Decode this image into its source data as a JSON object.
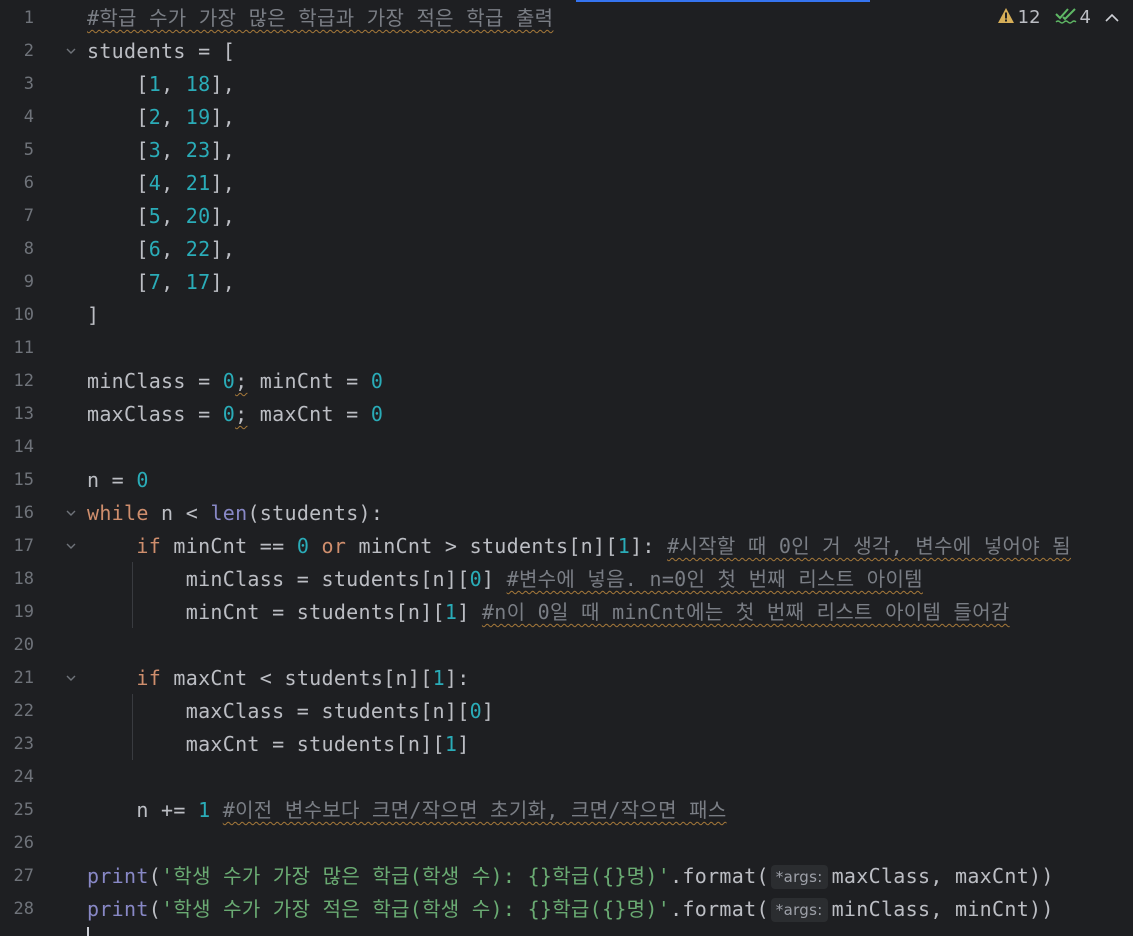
{
  "inspections": {
    "warnings_count": "12",
    "typos_count": "4",
    "warning_icon": "warning-triangle-icon",
    "typo_icon": "double-check-icon",
    "collapse_icon": "chevron-up-icon"
  },
  "colors": {
    "background": "#1e1f22",
    "keyword": "#cf8e6d",
    "number": "#2aacb8",
    "function": "#56a8f5",
    "string": "#6aab73",
    "comment": "#7a7e85"
  },
  "lines": [
    {
      "n": "1",
      "tokens": [
        {
          "t": "#학급 수가 가장 많은 학급과 가장 적은 학급 출력",
          "c": "cm"
        }
      ]
    },
    {
      "n": "2",
      "fold": true,
      "tokens": [
        {
          "t": "students = ["
        }
      ]
    },
    {
      "n": "3",
      "tokens": [
        {
          "t": "    ["
        },
        {
          "t": "1",
          "c": "num"
        },
        {
          "t": ", "
        },
        {
          "t": "18",
          "c": "num"
        },
        {
          "t": "],"
        }
      ]
    },
    {
      "n": "4",
      "tokens": [
        {
          "t": "    ["
        },
        {
          "t": "2",
          "c": "num"
        },
        {
          "t": ", "
        },
        {
          "t": "19",
          "c": "num"
        },
        {
          "t": "],"
        }
      ]
    },
    {
      "n": "5",
      "tokens": [
        {
          "t": "    ["
        },
        {
          "t": "3",
          "c": "num"
        },
        {
          "t": ", "
        },
        {
          "t": "23",
          "c": "num"
        },
        {
          "t": "],"
        }
      ]
    },
    {
      "n": "6",
      "tokens": [
        {
          "t": "    ["
        },
        {
          "t": "4",
          "c": "num"
        },
        {
          "t": ", "
        },
        {
          "t": "21",
          "c": "num"
        },
        {
          "t": "],"
        }
      ]
    },
    {
      "n": "7",
      "tokens": [
        {
          "t": "    ["
        },
        {
          "t": "5",
          "c": "num"
        },
        {
          "t": ", "
        },
        {
          "t": "20",
          "c": "num"
        },
        {
          "t": "],"
        }
      ]
    },
    {
      "n": "8",
      "tokens": [
        {
          "t": "    ["
        },
        {
          "t": "6",
          "c": "num"
        },
        {
          "t": ", "
        },
        {
          "t": "22",
          "c": "num"
        },
        {
          "t": "],"
        }
      ]
    },
    {
      "n": "9",
      "tokens": [
        {
          "t": "    ["
        },
        {
          "t": "7",
          "c": "num"
        },
        {
          "t": ", "
        },
        {
          "t": "17",
          "c": "num"
        },
        {
          "t": "],"
        }
      ]
    },
    {
      "n": "10",
      "tokens": [
        {
          "t": "]"
        }
      ]
    },
    {
      "n": "11",
      "tokens": []
    },
    {
      "n": "12",
      "tokens": [
        {
          "t": "minClass = "
        },
        {
          "t": "0",
          "c": "num"
        },
        {
          "t": ";",
          "c": "wv"
        },
        {
          "t": " minCnt = "
        },
        {
          "t": "0",
          "c": "num"
        }
      ]
    },
    {
      "n": "13",
      "tokens": [
        {
          "t": "maxClass = "
        },
        {
          "t": "0",
          "c": "num"
        },
        {
          "t": ";",
          "c": "wv"
        },
        {
          "t": " maxCnt = "
        },
        {
          "t": "0",
          "c": "num"
        }
      ]
    },
    {
      "n": "14",
      "tokens": []
    },
    {
      "n": "15",
      "tokens": [
        {
          "t": "n = "
        },
        {
          "t": "0",
          "c": "num"
        }
      ]
    },
    {
      "n": "16",
      "fold": true,
      "tokens": [
        {
          "t": "while",
          "c": "kw"
        },
        {
          "t": " n < "
        },
        {
          "t": "len",
          "c": "bi"
        },
        {
          "t": "(students):"
        }
      ]
    },
    {
      "n": "17",
      "fold": true,
      "tokens": [
        {
          "t": "    "
        },
        {
          "t": "if",
          "c": "kw"
        },
        {
          "t": " minCnt == "
        },
        {
          "t": "0",
          "c": "num"
        },
        {
          "t": " "
        },
        {
          "t": "or",
          "c": "kw"
        },
        {
          "t": " minCnt > students[n]["
        },
        {
          "t": "1",
          "c": "num"
        },
        {
          "t": "]: "
        },
        {
          "t": "#시작할 때 0인 거 생각, 변수에 넣어야 됨",
          "c": "cm"
        }
      ]
    },
    {
      "n": "18",
      "tokens": [
        {
          "t": "        minClass = students[n]["
        },
        {
          "t": "0",
          "c": "num"
        },
        {
          "t": "] "
        },
        {
          "t": "#변수에 넣음. n=0인 첫 번째 리스트 아이템",
          "c": "cm"
        }
      ]
    },
    {
      "n": "19",
      "tokens": [
        {
          "t": "        minCnt = students[n]["
        },
        {
          "t": "1",
          "c": "num"
        },
        {
          "t": "] "
        },
        {
          "t": "#n이 0일 때 minCnt에는 첫 번째 리스트 아이템 들어감",
          "c": "cm"
        }
      ]
    },
    {
      "n": "20",
      "tokens": []
    },
    {
      "n": "21",
      "fold": true,
      "tokens": [
        {
          "t": "    "
        },
        {
          "t": "if",
          "c": "kw"
        },
        {
          "t": " maxCnt < students[n]["
        },
        {
          "t": "1",
          "c": "num"
        },
        {
          "t": "]:"
        }
      ]
    },
    {
      "n": "22",
      "tokens": [
        {
          "t": "        maxClass = students[n]["
        },
        {
          "t": "0",
          "c": "num"
        },
        {
          "t": "]"
        }
      ]
    },
    {
      "n": "23",
      "tokens": [
        {
          "t": "        maxCnt = students[n]["
        },
        {
          "t": "1",
          "c": "num"
        },
        {
          "t": "]"
        }
      ]
    },
    {
      "n": "24",
      "tokens": []
    },
    {
      "n": "25",
      "tokens": [
        {
          "t": "    n += "
        },
        {
          "t": "1",
          "c": "num"
        },
        {
          "t": " "
        },
        {
          "t": "#이전 변수보다 크면/작으면 초기화, 크면/작으면 패스",
          "c": "cm"
        }
      ]
    },
    {
      "n": "26",
      "tokens": []
    },
    {
      "n": "27",
      "tokens": [
        {
          "t": "print",
          "c": "bi"
        },
        {
          "t": "("
        },
        {
          "t": "'학생 수가 가장 많은 학급(학생 수): {}학급({}명)'",
          "c": "str"
        },
        {
          "t": ".format("
        },
        {
          "t": "*args:",
          "c": "hint"
        },
        {
          "t": "maxClass, maxCnt))"
        }
      ]
    },
    {
      "n": "28",
      "tokens": [
        {
          "t": "print",
          "c": "bi"
        },
        {
          "t": "("
        },
        {
          "t": "'학생 수가 가장 적은 학급(학생 수): {}학급({}명)'",
          "c": "str"
        },
        {
          "t": ".format("
        },
        {
          "t": "*args:",
          "c": "hint"
        },
        {
          "t": "minClass, minCnt))"
        }
      ]
    }
  ]
}
